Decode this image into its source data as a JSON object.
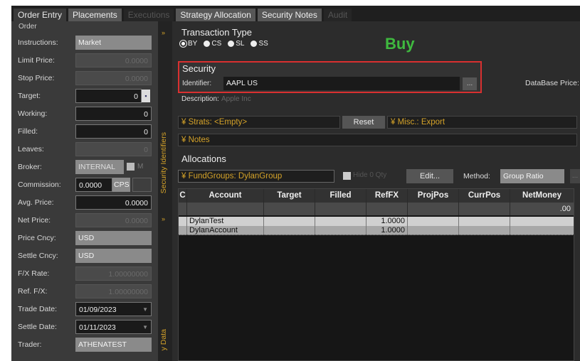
{
  "tabs": [
    {
      "label": "Order Entry"
    },
    {
      "label": "Placements"
    },
    {
      "label": "Executions"
    },
    {
      "label": "Strategy Allocation"
    },
    {
      "label": "Security Notes"
    },
    {
      "label": "Audit"
    }
  ],
  "order": {
    "group_label": "Order",
    "instructions": {
      "label": "Instructions:",
      "value": "Market"
    },
    "limit_price": {
      "label": "Limit Price:",
      "value": "0.0000"
    },
    "stop_price": {
      "label": "Stop Price:",
      "value": "0.0000"
    },
    "target": {
      "label": "Target:",
      "value": "0"
    },
    "working": {
      "label": "Working:",
      "value": "0"
    },
    "filled": {
      "label": "Filled:",
      "value": "0"
    },
    "leaves": {
      "label": "Leaves:",
      "value": "0"
    },
    "broker": {
      "label": "Broker:",
      "value": "INTERNAL",
      "m": "M"
    },
    "commission": {
      "label": "Commission:",
      "value": "0.0000",
      "unit": "CPS"
    },
    "avg_price": {
      "label": "Avg. Price:",
      "value": "0.0000"
    },
    "net_price": {
      "label": "Net Price:",
      "value": "0.0000"
    },
    "price_ccy": {
      "label": "Price Cncy:",
      "value": "USD"
    },
    "settle_ccy": {
      "label": "Settle Cncy:",
      "value": "USD"
    },
    "fx_rate": {
      "label": "F/X Rate:",
      "value": "1.00000000"
    },
    "ref_fx": {
      "label": "Ref. F/X:",
      "value": "1.00000000"
    },
    "trade_date": {
      "label": "Trade Date:",
      "value": "01/09/2023"
    },
    "settle_date": {
      "label": "Settle Date:",
      "value": "01/11/2023"
    },
    "trader": {
      "label": "Trader:",
      "value": "ATHENATEST"
    }
  },
  "side_tabs": {
    "security_identifiers": "Security Identifiers",
    "security_data": "y Data",
    "chevron": "»"
  },
  "transaction": {
    "title": "Transaction Type",
    "options": [
      "BY",
      "CS",
      "SL",
      "SS"
    ],
    "selected": "BY",
    "side_display": "Buy"
  },
  "security": {
    "title": "Security",
    "identifier_label": "Identifier:",
    "identifier_value": "AAPL US",
    "browse": "...",
    "database_price_label": "DataBase Price:",
    "description_label": "Description:",
    "description_value": "Apple Inc"
  },
  "strats": {
    "label": "Strats: <Empty>",
    "reset": "Reset",
    "misc": "Misc.: Export"
  },
  "notes": {
    "label": "Notes"
  },
  "allocations": {
    "title": "Allocations",
    "fund_groups": "FundGroups: DylanGroup",
    "hide_zero": "Hide 0 Qty",
    "edit": "Edit...",
    "method_label": "Method:",
    "method_value": "Group Ratio",
    "more": "...",
    "columns": [
      "C",
      "Account",
      "Target",
      "Filled",
      "RefFX",
      "ProjPos",
      "CurrPos",
      "NetMoney"
    ],
    "total_netmoney": ".00",
    "rows": [
      {
        "account": "DylanTest",
        "reffx": "1.0000"
      },
      {
        "account": "DylanAccount",
        "reffx": "1.0000"
      }
    ]
  },
  "colors": {
    "accent": "#d4a229",
    "buy": "#3fba3f",
    "highlight": "#d93030"
  }
}
